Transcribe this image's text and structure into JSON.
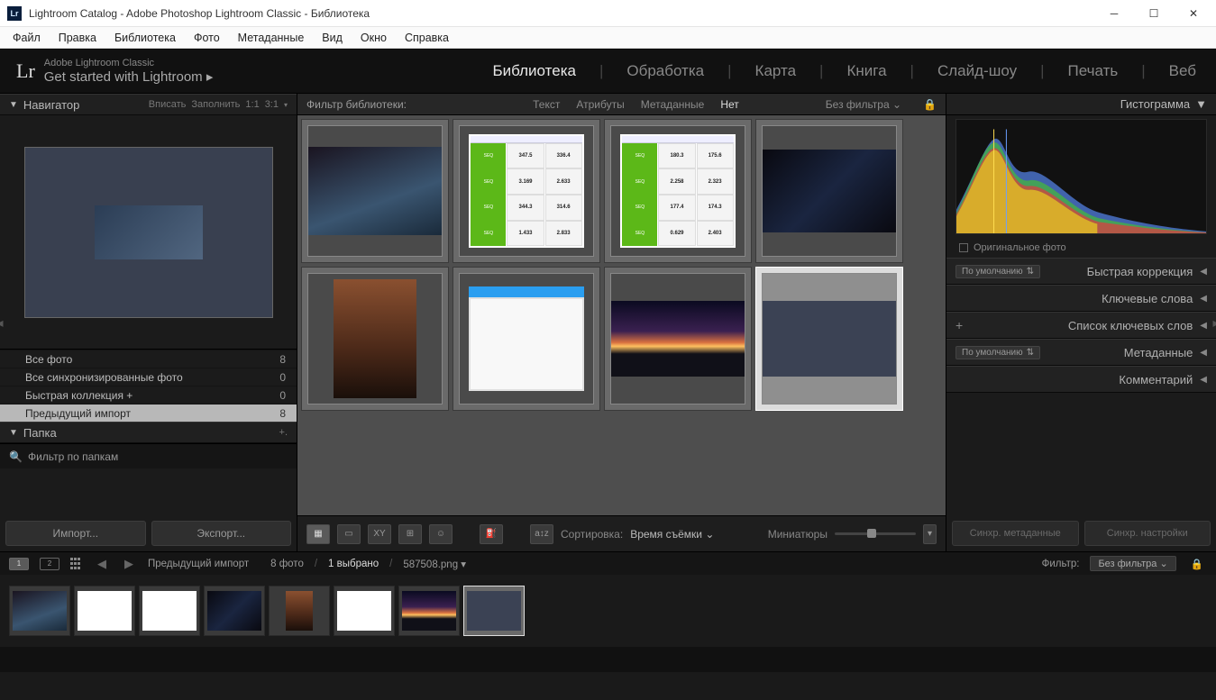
{
  "window": {
    "title": "Lightroom Catalog - Adobe Photoshop Lightroom Classic - Библиотека"
  },
  "menu": [
    "Файл",
    "Правка",
    "Библиотека",
    "Фото",
    "Метаданные",
    "Вид",
    "Окно",
    "Справка"
  ],
  "identity": {
    "product": "Adobe Lightroom Classic",
    "tagline": "Get started with Lightroom",
    "modules": [
      "Библиотека",
      "Обработка",
      "Карта",
      "Книга",
      "Слайд-шоу",
      "Печать",
      "Веб"
    ]
  },
  "navigator": {
    "title": "Навигатор",
    "opts": [
      "Вписать",
      "Заполнить",
      "1:1",
      "3:1"
    ]
  },
  "catalog": [
    {
      "label": "Все фото",
      "count": "8"
    },
    {
      "label": "Все синхронизированные фото",
      "count": "0"
    },
    {
      "label": "Быстрая коллекция  +",
      "count": "0"
    },
    {
      "label": "Предыдущий импорт",
      "count": "8"
    }
  ],
  "folders": {
    "title": "Папка",
    "filter_placeholder": "Фильтр по папкам"
  },
  "left_buttons": {
    "import": "Импорт...",
    "export": "Экспорт..."
  },
  "filterbar": {
    "label": "Фильтр библиотеки:",
    "tabs": [
      "Текст",
      "Атрибуты",
      "Метаданные",
      "Нет"
    ],
    "nofilter": "Без фильтра"
  },
  "toolbar": {
    "sort_label": "Сортировка:",
    "sort_value": "Время съёмки",
    "thumb_label": "Миниатюры"
  },
  "right": {
    "histogram": "Гистограмма",
    "original": "Оригинальное фото",
    "default": "По умолчанию",
    "quick": "Быстрая коррекция",
    "keywords": "Ключевые слова",
    "keyword_list": "Список ключевых слов",
    "metadata": "Метаданные",
    "comments": "Комментарий",
    "sync_meta": "Синхр. метаданные",
    "sync_set": "Синхр. настройки"
  },
  "filmstrip_head": {
    "source": "Предыдущий импорт",
    "count": "8 фото",
    "selected": "1 выбрано",
    "file": "587508.png",
    "filter_label": "Фильтр:",
    "filter_value": "Без фильтра"
  },
  "bench1": [
    [
      "347.5",
      "336.4"
    ],
    [
      "3.169",
      "2.633"
    ],
    [
      "344.3",
      "314.6"
    ],
    [
      "1.433",
      "2.833"
    ]
  ],
  "bench2": [
    [
      "180.3",
      "175.6"
    ],
    [
      "2.258",
      "2.323"
    ],
    [
      "177.4",
      "174.3"
    ],
    [
      "0.629",
      "2.403"
    ]
  ]
}
